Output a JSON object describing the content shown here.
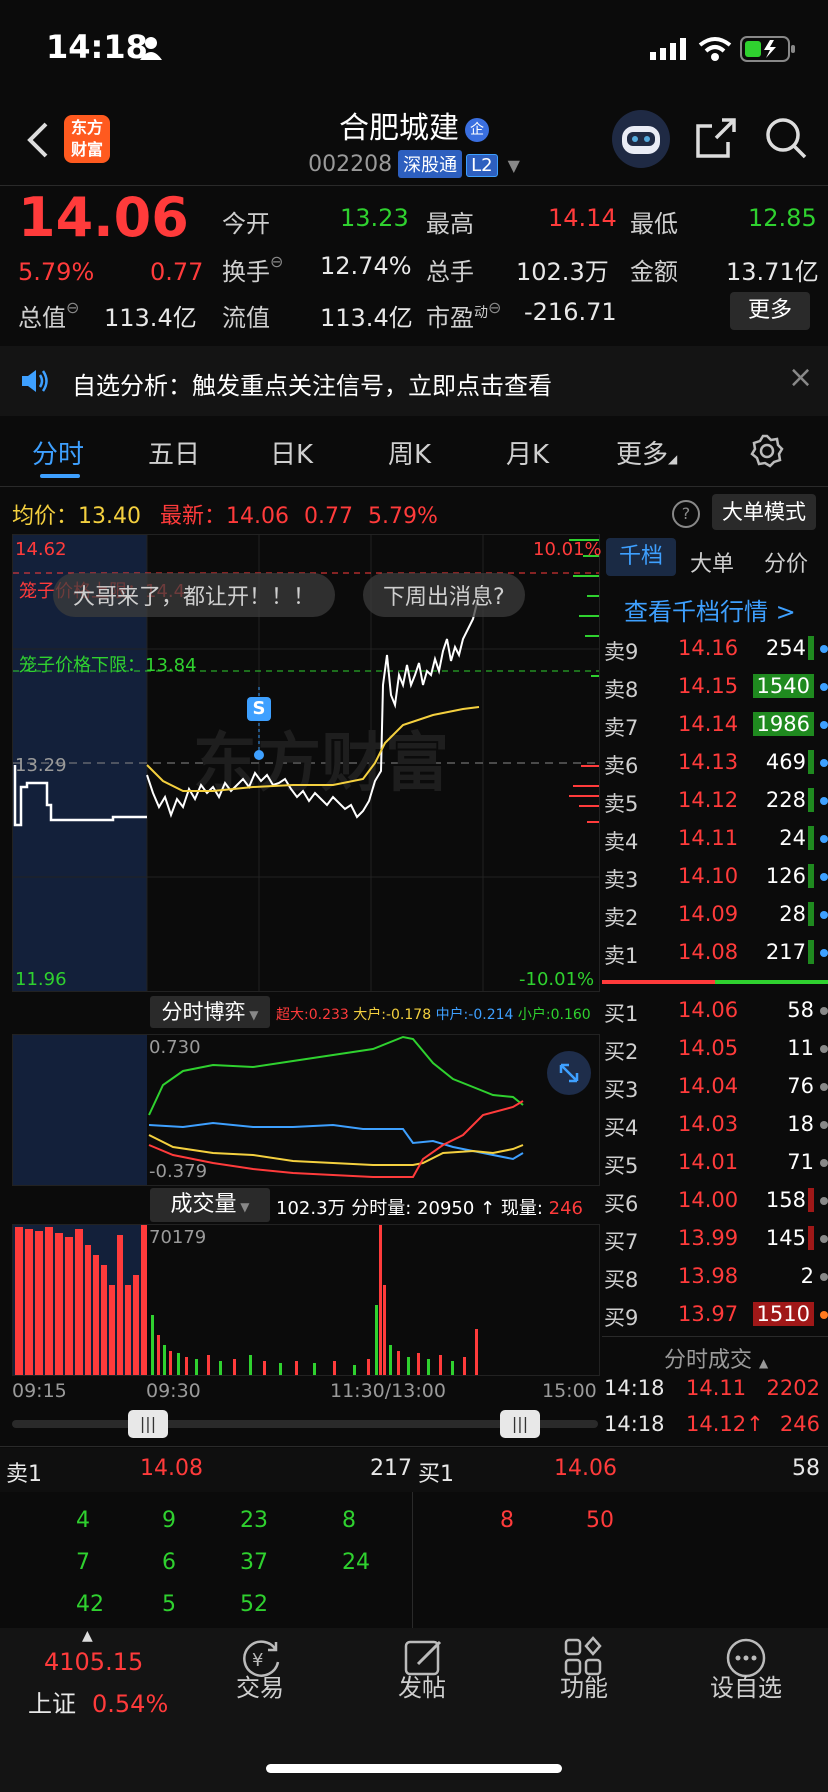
{
  "status": {
    "time": "14:18"
  },
  "header": {
    "logo_text_1": "东方",
    "logo_text_2": "财富",
    "stock_name": "合肥城建",
    "stock_badge": "企",
    "stock_code": "002208",
    "tag_connect": "深股通",
    "tag_level": "L2"
  },
  "quote": {
    "price": "14.06",
    "change_pct": "5.79%",
    "change": "0.77",
    "open_label": "今开",
    "open": "13.23",
    "high_label": "最高",
    "high": "14.14",
    "low_label": "最低",
    "low": "12.85",
    "turnover_label": "换手",
    "turnover": "12.74%",
    "volume_label": "总手",
    "volume": "102.3万",
    "amount_label": "金额",
    "amount": "13.71亿",
    "mktcap_label": "总值",
    "mktcap": "113.4亿",
    "float_label": "流值",
    "float": "113.4亿",
    "pe_label": "市盈",
    "pe_sup": "动",
    "pe": "-216.71",
    "more_label": "更多"
  },
  "notice": {
    "text": "自选分析：触发重点关注信号，立即点击查看",
    "close": "×"
  },
  "tabs": [
    {
      "label": "分时"
    },
    {
      "label": "五日"
    },
    {
      "label": "日K"
    },
    {
      "label": "周K"
    },
    {
      "label": "月K"
    },
    {
      "label": "更多"
    }
  ],
  "chart_header": {
    "avg_label": "均价：",
    "avg": "13.40",
    "latest_label": "最新：",
    "latest": "14.06",
    "latest_chg": "0.77",
    "latest_pct": "5.79%",
    "help": "?",
    "mode_btn": "大单模式"
  },
  "chart": {
    "y_top": "14.62",
    "y_bottom": "11.96",
    "y_mid": "13.29",
    "pct_top": "10.01%",
    "pct_bottom": "-10.01%",
    "upper_limit_label": "笼子价格上限：14.4",
    "lower_limit_label": "笼子价格下限：13.84",
    "pill_1": "大哥来了，都让开！！！",
    "pill_2": "下周出消息?",
    "s_marker": "S",
    "watermark": "东方财富"
  },
  "bobo": {
    "label": "分时博弈",
    "super_label": "超大:0.233",
    "big_label": "大户:-0.178",
    "mid_label": "中户:-0.214",
    "small_label": "小户:0.160",
    "y_top": "0.730",
    "y_bottom": "-0.379"
  },
  "volume": {
    "label": "成交量",
    "info": "102.3万 分时量: 20950 ↑ 现量: ",
    "now": "246",
    "y_top": "70179",
    "times": [
      "09:15",
      "09:30",
      "11:30/13:00",
      "15:00"
    ]
  },
  "orderbook": {
    "tabs": [
      "千档",
      "大单",
      "分价"
    ],
    "link": "查看千档行情 >",
    "asks": [
      {
        "name": "卖9",
        "price": "14.16",
        "vol": "254"
      },
      {
        "name": "卖8",
        "price": "14.15",
        "vol": "1540"
      },
      {
        "name": "卖7",
        "price": "14.14",
        "vol": "1986"
      },
      {
        "name": "卖6",
        "price": "14.13",
        "vol": "469"
      },
      {
        "name": "卖5",
        "price": "14.12",
        "vol": "228"
      },
      {
        "name": "卖4",
        "price": "14.11",
        "vol": "24"
      },
      {
        "name": "卖3",
        "price": "14.10",
        "vol": "126"
      },
      {
        "name": "卖2",
        "price": "14.09",
        "vol": "28"
      },
      {
        "name": "卖1",
        "price": "14.08",
        "vol": "217"
      }
    ],
    "bids": [
      {
        "name": "买1",
        "price": "14.06",
        "vol": "58"
      },
      {
        "name": "买2",
        "price": "14.05",
        "vol": "11"
      },
      {
        "name": "买3",
        "price": "14.04",
        "vol": "76"
      },
      {
        "name": "买4",
        "price": "14.03",
        "vol": "18"
      },
      {
        "name": "买5",
        "price": "14.01",
        "vol": "71"
      },
      {
        "name": "买6",
        "price": "14.00",
        "vol": "158"
      },
      {
        "name": "买7",
        "price": "13.99",
        "vol": "145"
      },
      {
        "name": "买8",
        "price": "13.98",
        "vol": "2"
      },
      {
        "name": "买9",
        "price": "13.97",
        "vol": "1510"
      }
    ],
    "trades_title": "分时成交",
    "trades": [
      {
        "time": "14:18",
        "price": "14.11",
        "vol": "2202"
      },
      {
        "time": "14:18",
        "price": "14.12↑",
        "vol": "246"
      }
    ]
  },
  "bottom": {
    "sell_label": "卖1",
    "sell_price": "14.08",
    "sell_vol": "217",
    "buy_label": "买1",
    "buy_price": "14.06",
    "buy_vol": "58",
    "sell_rows": [
      [
        "4",
        "9",
        "23",
        "8"
      ],
      [
        "7",
        "6",
        "37",
        "24"
      ],
      [
        "42",
        "5",
        "52",
        ""
      ]
    ],
    "buy_rows": [
      [
        "8",
        "50"
      ]
    ]
  },
  "nav": {
    "index_value": "4105.15",
    "index_name": "上证",
    "index_pct": "0.54%",
    "items": [
      "交易",
      "发帖",
      "功能",
      "设自选"
    ]
  }
}
